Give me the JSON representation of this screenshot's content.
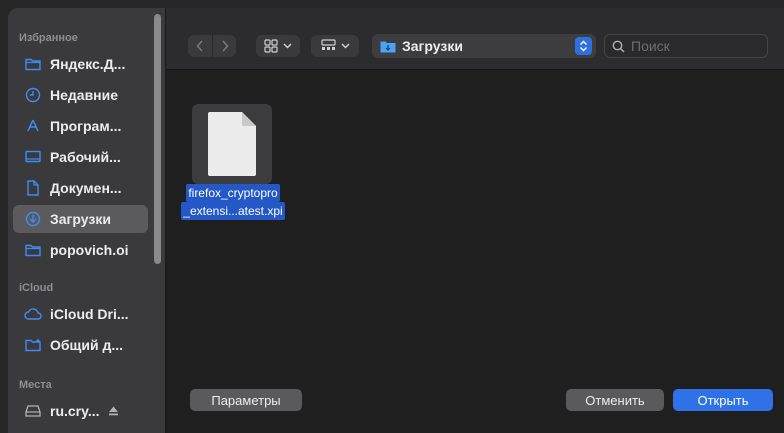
{
  "sidebar": {
    "favorites_label": "Избранное",
    "favorites": [
      {
        "label": "Яндекс.Д...",
        "icon": "folder-icon"
      },
      {
        "label": "Недавние",
        "icon": "clock-icon"
      },
      {
        "label": "Програм...",
        "icon": "applications-icon"
      },
      {
        "label": "Рабочий...",
        "icon": "desktop-icon"
      },
      {
        "label": "Докумен...",
        "icon": "document-icon"
      },
      {
        "label": "Загрузки",
        "icon": "download-icon",
        "selected": true
      },
      {
        "label": "popovich.oi",
        "icon": "folder-icon"
      }
    ],
    "icloud_label": "iCloud",
    "icloud": [
      {
        "label": "iCloud Dri...",
        "icon": "cloud-icon"
      },
      {
        "label": "Общий д...",
        "icon": "shared-folder-icon"
      }
    ],
    "places_label": "Места",
    "places": [
      {
        "label": "ru.cry...",
        "icon": "disk-icon"
      }
    ]
  },
  "toolbar": {
    "location": "Загрузки",
    "search_placeholder": "Поиск"
  },
  "files": [
    {
      "name_line1": "firefox_cryptopro",
      "name_line2": "_extensi...atest.xpi",
      "selected": true
    }
  ],
  "buttons": {
    "options": "Параметры",
    "cancel": "Отменить",
    "open": "Открыть"
  },
  "colors": {
    "accent": "#2f72e8",
    "selection": "#2458c7",
    "sidebar_icon": "#3d8cf7"
  }
}
